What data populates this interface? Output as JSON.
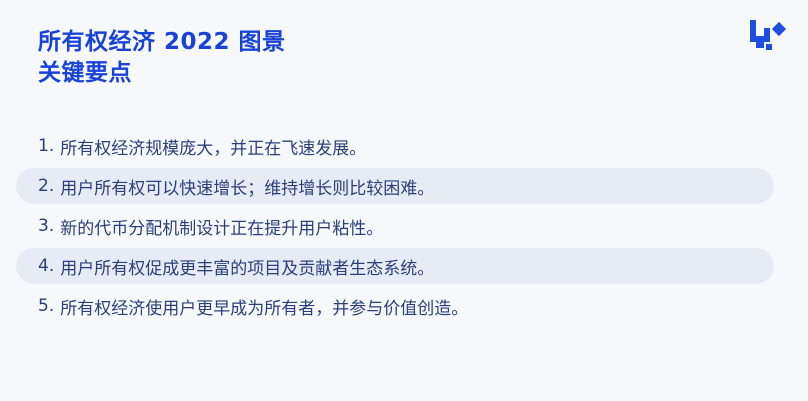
{
  "title": {
    "line1": "所有权经济 2022 图景",
    "line2": "关键要点"
  },
  "logo": {
    "icon": "brand-logo-icon",
    "color": "#1d4ee0"
  },
  "points": [
    {
      "num": "1.",
      "text": "所有权经济规模庞大，并正在飞速发展。",
      "highlighted": false
    },
    {
      "num": "2.",
      "text": "用户所有权可以快速增长；维持增长则比较困难。",
      "highlighted": true
    },
    {
      "num": "3.",
      "text": "新的代币分配机制设计正在提升用户粘性。",
      "highlighted": false
    },
    {
      "num": "4.",
      "text": "用户所有权促成更丰富的项目及贡献者生态系统。",
      "highlighted": true
    },
    {
      "num": "5.",
      "text": "所有权经济使用户更早成为所有者，并参与价值创造。",
      "highlighted": false
    }
  ],
  "colors": {
    "title": "#1842d8",
    "body_text": "#2a3f7a",
    "highlight_row": "#e7ebf6",
    "background": "#f7f8fc"
  }
}
